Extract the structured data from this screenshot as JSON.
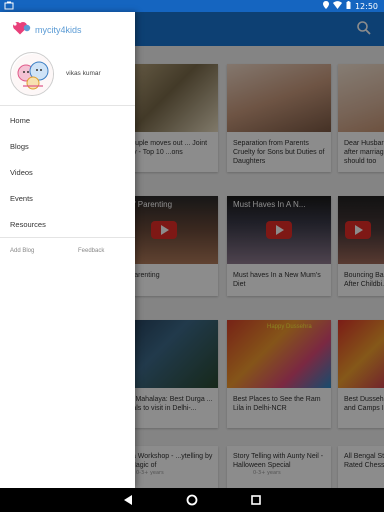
{
  "status_bar": {
    "time": "12:50",
    "icons": [
      "notification-icon",
      "location-icon",
      "wifi-icon",
      "battery-icon"
    ]
  },
  "app_bar": {
    "search_icon": "search-icon",
    "color": "#1976d2"
  },
  "drawer": {
    "logo_text": "mycity4kids",
    "user_name": "vikas kumar",
    "menu": [
      {
        "label": "Home"
      },
      {
        "label": "Blogs"
      },
      {
        "label": "Videos"
      },
      {
        "label": "Events"
      },
      {
        "label": "Resources"
      }
    ],
    "add_blog": "Add Blog",
    "feedback": "Feedback"
  },
  "content": {
    "row1": [
      {
        "title": "...a couple moves out ... Joint Family - Top 10 ...ons"
      },
      {
        "title": "Separation from Parents Cruelty for Sons but Duties of Daughters"
      },
      {
        "title": "Dear Husbar ... after marriag... should too"
      }
    ],
    "row2": [
      {
        "overlay": "...s of Parenting",
        "title": "...of Parenting"
      },
      {
        "overlay": "Must Haves In A N...",
        "title": "Must haves In a New Mum's Diet"
      },
      {
        "overlay": "",
        "title": "Bouncing Ba... After Childbi..."
      }
    ],
    "row3": [
      {
        "title": "...pho Mahalaya: Best Durga ... Pandals to visit in Delhi-..."
      },
      {
        "overlay": "Happy Dussehra",
        "title": "Best Places to See the Ram Lila in Delhi-NCR"
      },
      {
        "title": "Best Dusseh... and Camps I..."
      }
    ],
    "row4": [
      {
        "title": "...ehra Workshop - ...ytelling by The Magic of",
        "meta": "0-3+ years"
      },
      {
        "title": "Story Telling with Aunty Neil - Halloween Special",
        "meta": "0-3+ years"
      },
      {
        "title": "All Bengal St... Rated Chess..."
      }
    ]
  },
  "nav_bar": {
    "back": "back-icon",
    "home": "home-icon",
    "recents": "recents-icon"
  }
}
